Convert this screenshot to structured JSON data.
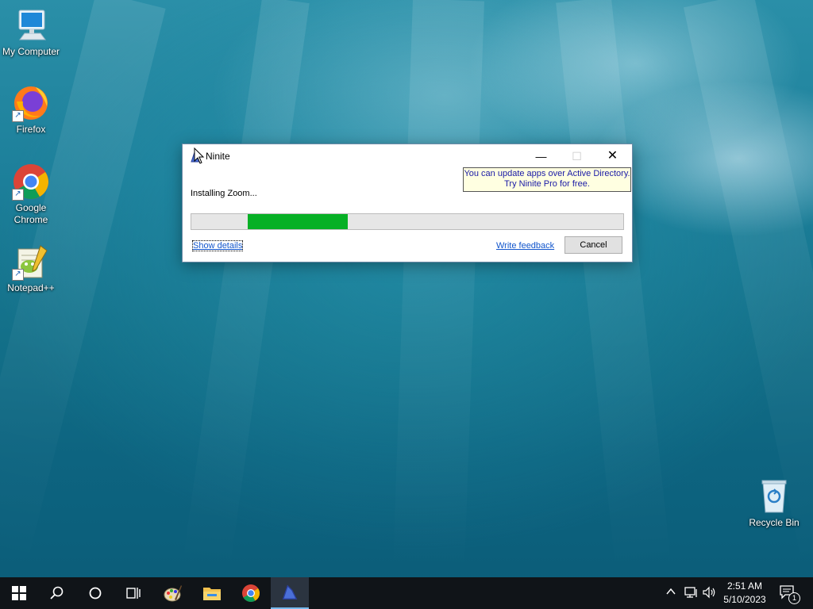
{
  "desktop": {
    "icons": [
      {
        "label": "My Computer",
        "icon": "computer-icon"
      },
      {
        "label": "Firefox",
        "icon": "firefox-icon"
      },
      {
        "label": "Google\nChrome",
        "icon": "chrome-icon"
      },
      {
        "label": "Notepad++",
        "icon": "notepadpp-icon"
      },
      {
        "label": "Recycle Bin",
        "icon": "recycle-bin-icon"
      }
    ]
  },
  "dialog": {
    "title": "Ninite",
    "minimize_glyph": "—",
    "maximize_glyph": "☐",
    "close_glyph": "✕",
    "promo_line1": "You can update apps over Active Directory.",
    "promo_line2": "Try Ninite Pro for free.",
    "status": "Installing Zoom...",
    "progress": {
      "start_fraction": 0.13,
      "end_fraction": 0.363
    },
    "show_details": "Show details",
    "write_feedback": "Write feedback",
    "cancel": "Cancel",
    "colors": {
      "progress_fill": "#06b025",
      "link": "#1155cc",
      "promo_bg": "#ffffe1"
    }
  },
  "taskbar": {
    "items": [
      "start-icon",
      "search-icon",
      "cortana-icon",
      "task-view-icon",
      "paint-icon",
      "file-explorer-icon",
      "chrome-icon",
      "ninite-icon"
    ],
    "active_item": "ninite-icon",
    "time": "2:51 AM",
    "date": "5/10/2023",
    "notification_count": "1"
  }
}
